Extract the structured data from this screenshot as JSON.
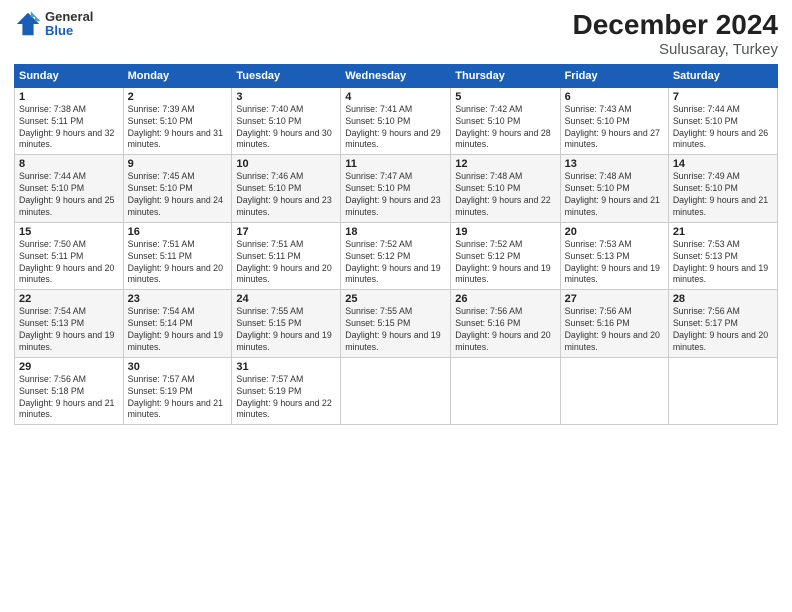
{
  "logo": {
    "general": "General",
    "blue": "Blue"
  },
  "title": "December 2024",
  "subtitle": "Sulusaray, Turkey",
  "weekdays": [
    "Sunday",
    "Monday",
    "Tuesday",
    "Wednesday",
    "Thursday",
    "Friday",
    "Saturday"
  ],
  "weeks": [
    [
      {
        "day": "1",
        "info": "Sunrise: 7:38 AM\nSunset: 5:11 PM\nDaylight: 9 hours and 32 minutes."
      },
      {
        "day": "2",
        "info": "Sunrise: 7:39 AM\nSunset: 5:10 PM\nDaylight: 9 hours and 31 minutes."
      },
      {
        "day": "3",
        "info": "Sunrise: 7:40 AM\nSunset: 5:10 PM\nDaylight: 9 hours and 30 minutes."
      },
      {
        "day": "4",
        "info": "Sunrise: 7:41 AM\nSunset: 5:10 PM\nDaylight: 9 hours and 29 minutes."
      },
      {
        "day": "5",
        "info": "Sunrise: 7:42 AM\nSunset: 5:10 PM\nDaylight: 9 hours and 28 minutes."
      },
      {
        "day": "6",
        "info": "Sunrise: 7:43 AM\nSunset: 5:10 PM\nDaylight: 9 hours and 27 minutes."
      },
      {
        "day": "7",
        "info": "Sunrise: 7:44 AM\nSunset: 5:10 PM\nDaylight: 9 hours and 26 minutes."
      }
    ],
    [
      {
        "day": "8",
        "info": "Sunrise: 7:44 AM\nSunset: 5:10 PM\nDaylight: 9 hours and 25 minutes."
      },
      {
        "day": "9",
        "info": "Sunrise: 7:45 AM\nSunset: 5:10 PM\nDaylight: 9 hours and 24 minutes."
      },
      {
        "day": "10",
        "info": "Sunrise: 7:46 AM\nSunset: 5:10 PM\nDaylight: 9 hours and 23 minutes."
      },
      {
        "day": "11",
        "info": "Sunrise: 7:47 AM\nSunset: 5:10 PM\nDaylight: 9 hours and 23 minutes."
      },
      {
        "day": "12",
        "info": "Sunrise: 7:48 AM\nSunset: 5:10 PM\nDaylight: 9 hours and 22 minutes."
      },
      {
        "day": "13",
        "info": "Sunrise: 7:48 AM\nSunset: 5:10 PM\nDaylight: 9 hours and 21 minutes."
      },
      {
        "day": "14",
        "info": "Sunrise: 7:49 AM\nSunset: 5:10 PM\nDaylight: 9 hours and 21 minutes."
      }
    ],
    [
      {
        "day": "15",
        "info": "Sunrise: 7:50 AM\nSunset: 5:11 PM\nDaylight: 9 hours and 20 minutes."
      },
      {
        "day": "16",
        "info": "Sunrise: 7:51 AM\nSunset: 5:11 PM\nDaylight: 9 hours and 20 minutes."
      },
      {
        "day": "17",
        "info": "Sunrise: 7:51 AM\nSunset: 5:11 PM\nDaylight: 9 hours and 20 minutes."
      },
      {
        "day": "18",
        "info": "Sunrise: 7:52 AM\nSunset: 5:12 PM\nDaylight: 9 hours and 19 minutes."
      },
      {
        "day": "19",
        "info": "Sunrise: 7:52 AM\nSunset: 5:12 PM\nDaylight: 9 hours and 19 minutes."
      },
      {
        "day": "20",
        "info": "Sunrise: 7:53 AM\nSunset: 5:13 PM\nDaylight: 9 hours and 19 minutes."
      },
      {
        "day": "21",
        "info": "Sunrise: 7:53 AM\nSunset: 5:13 PM\nDaylight: 9 hours and 19 minutes."
      }
    ],
    [
      {
        "day": "22",
        "info": "Sunrise: 7:54 AM\nSunset: 5:13 PM\nDaylight: 9 hours and 19 minutes."
      },
      {
        "day": "23",
        "info": "Sunrise: 7:54 AM\nSunset: 5:14 PM\nDaylight: 9 hours and 19 minutes."
      },
      {
        "day": "24",
        "info": "Sunrise: 7:55 AM\nSunset: 5:15 PM\nDaylight: 9 hours and 19 minutes."
      },
      {
        "day": "25",
        "info": "Sunrise: 7:55 AM\nSunset: 5:15 PM\nDaylight: 9 hours and 19 minutes."
      },
      {
        "day": "26",
        "info": "Sunrise: 7:56 AM\nSunset: 5:16 PM\nDaylight: 9 hours and 20 minutes."
      },
      {
        "day": "27",
        "info": "Sunrise: 7:56 AM\nSunset: 5:16 PM\nDaylight: 9 hours and 20 minutes."
      },
      {
        "day": "28",
        "info": "Sunrise: 7:56 AM\nSunset: 5:17 PM\nDaylight: 9 hours and 20 minutes."
      }
    ],
    [
      {
        "day": "29",
        "info": "Sunrise: 7:56 AM\nSunset: 5:18 PM\nDaylight: 9 hours and 21 minutes."
      },
      {
        "day": "30",
        "info": "Sunrise: 7:57 AM\nSunset: 5:19 PM\nDaylight: 9 hours and 21 minutes."
      },
      {
        "day": "31",
        "info": "Sunrise: 7:57 AM\nSunset: 5:19 PM\nDaylight: 9 hours and 22 minutes."
      },
      null,
      null,
      null,
      null
    ]
  ]
}
